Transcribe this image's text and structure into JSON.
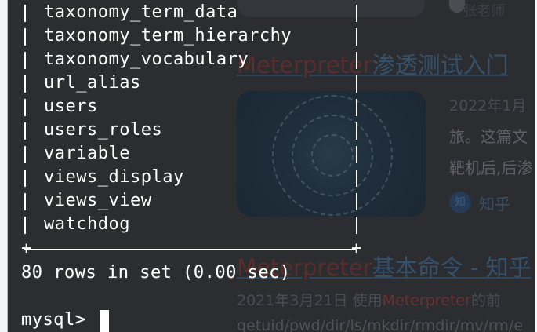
{
  "background_page": {
    "author": "张老师",
    "result1_title_highlight": "Meterpreter",
    "result1_title_rest": "渗透测试入门",
    "result1_date": "2022年1月",
    "result1_snippet_line1": "旅。这篇文",
    "result1_snippet_line2": "靶机后,后渗",
    "result1_source_icon": "知",
    "result1_source": "知乎",
    "result2_title_highlight": "Meterpreter",
    "result2_title_rest": "基本命令 - 知乎",
    "result2_date": "2021年3月21日 使用",
    "result2_snippet_highlight": "Meterpreter",
    "result2_snippet_rest": "的前",
    "result2_snippet_line2": "getuid/pwd/dir/ls/mkdir/rmdir/mv/rm/e"
  },
  "terminal": {
    "table_rows": [
      "taxonomy_term_data",
      "taxonomy_term_hierarchy",
      "taxonomy_vocabulary",
      "url_alias",
      "users",
      "users_roles",
      "variable",
      "views_display",
      "views_view",
      "watchdog"
    ],
    "border_char_left": "+",
    "border_char_right": "+",
    "result_summary": "80 rows in set (0.00 sec)",
    "prompt": "mysql> "
  },
  "colors": {
    "terminal_text": "#ffffff",
    "background_dim": "#2b2d30",
    "link_dim": "#35506b",
    "highlight_dim": "#5a2d2d"
  }
}
